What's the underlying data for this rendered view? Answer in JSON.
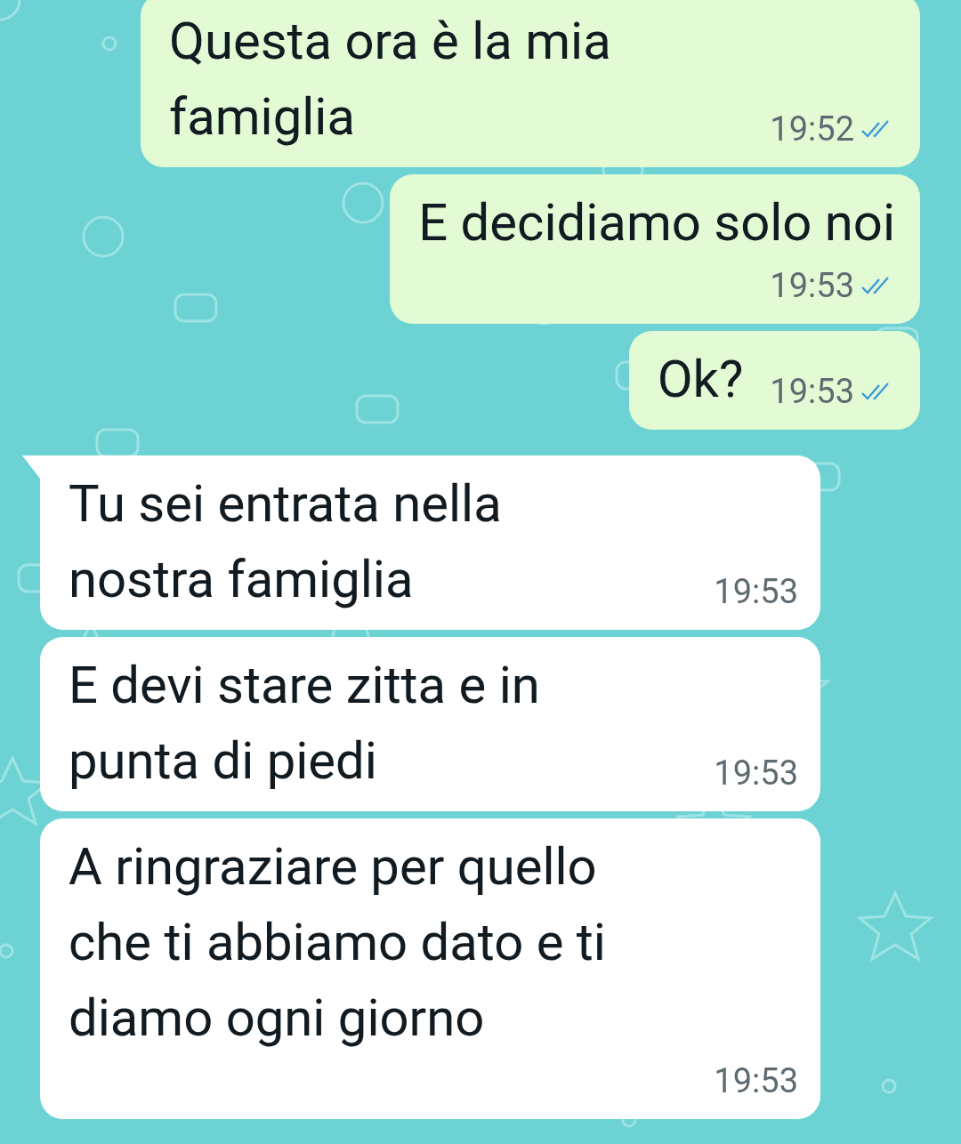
{
  "messages": [
    {
      "kind": "outgoing",
      "lines": [
        "Questa ora è la mia",
        "famiglia"
      ],
      "time": "19:52",
      "read": true,
      "tail": false
    },
    {
      "kind": "outgoing",
      "lines": [
        "E decidiamo solo noi"
      ],
      "time": "19:53",
      "read": true,
      "tail": false
    },
    {
      "kind": "outgoing",
      "lines": [
        "Ok?"
      ],
      "time": "19:53",
      "read": true,
      "tail": false
    },
    {
      "kind": "incoming",
      "lines": [
        "Tu sei entrata nella",
        "nostra famiglia"
      ],
      "time": "19:53",
      "tail": true
    },
    {
      "kind": "incoming",
      "lines": [
        "E devi stare zitta e in",
        "punta di piedi"
      ],
      "time": "19:53",
      "tail": false
    },
    {
      "kind": "incoming",
      "lines": [
        "A ringraziare per quello",
        "che ti abbiamo dato e ti",
        "diamo ogni giorno"
      ],
      "time": "19:53",
      "tail": false
    }
  ]
}
